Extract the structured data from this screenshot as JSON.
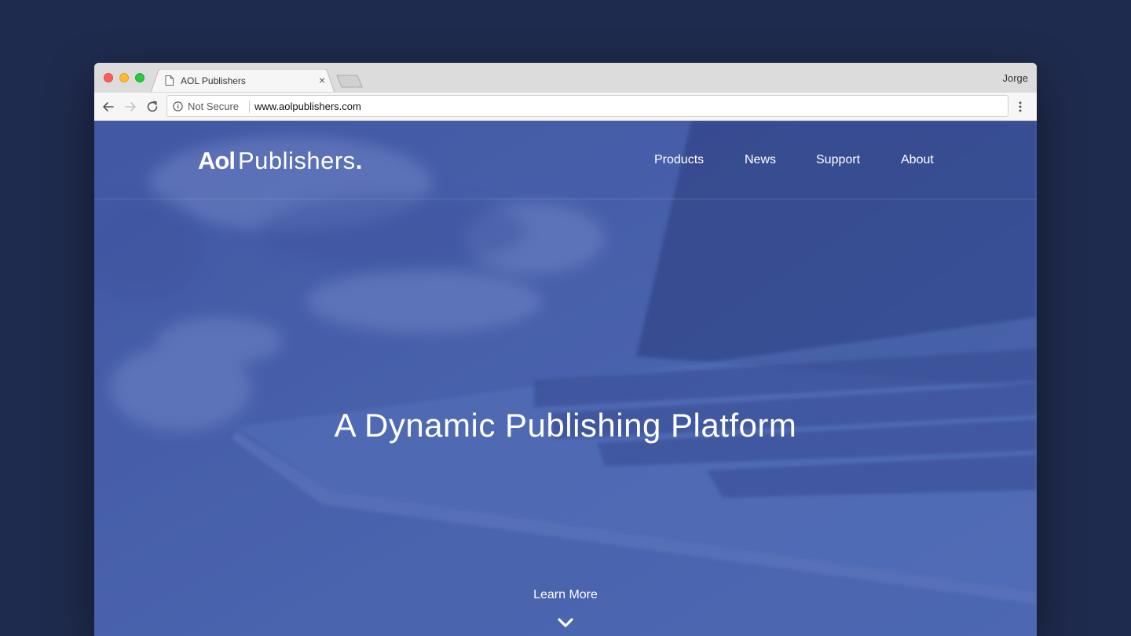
{
  "browser": {
    "tab": {
      "title": "AOL Publishers",
      "close_glyph": "×",
      "icon": "page-icon"
    },
    "profile_name": "Jorge",
    "security_label": "Not Secure",
    "url": "www.aolpublishers.com",
    "traffic_lights": {
      "close": "#fc5f57",
      "minimize": "#fdbc2e",
      "maximize": "#28c840"
    }
  },
  "site": {
    "logo": {
      "aol": "Aol",
      "publishers": "Publishers",
      "dot": "."
    },
    "nav": [
      "Products",
      "News",
      "Support",
      "About"
    ],
    "hero_title": "A Dynamic Publishing Platform",
    "learn_more": "Learn More",
    "accent_color": "#4a63ae"
  },
  "desktop_background": "#1f2b4e"
}
